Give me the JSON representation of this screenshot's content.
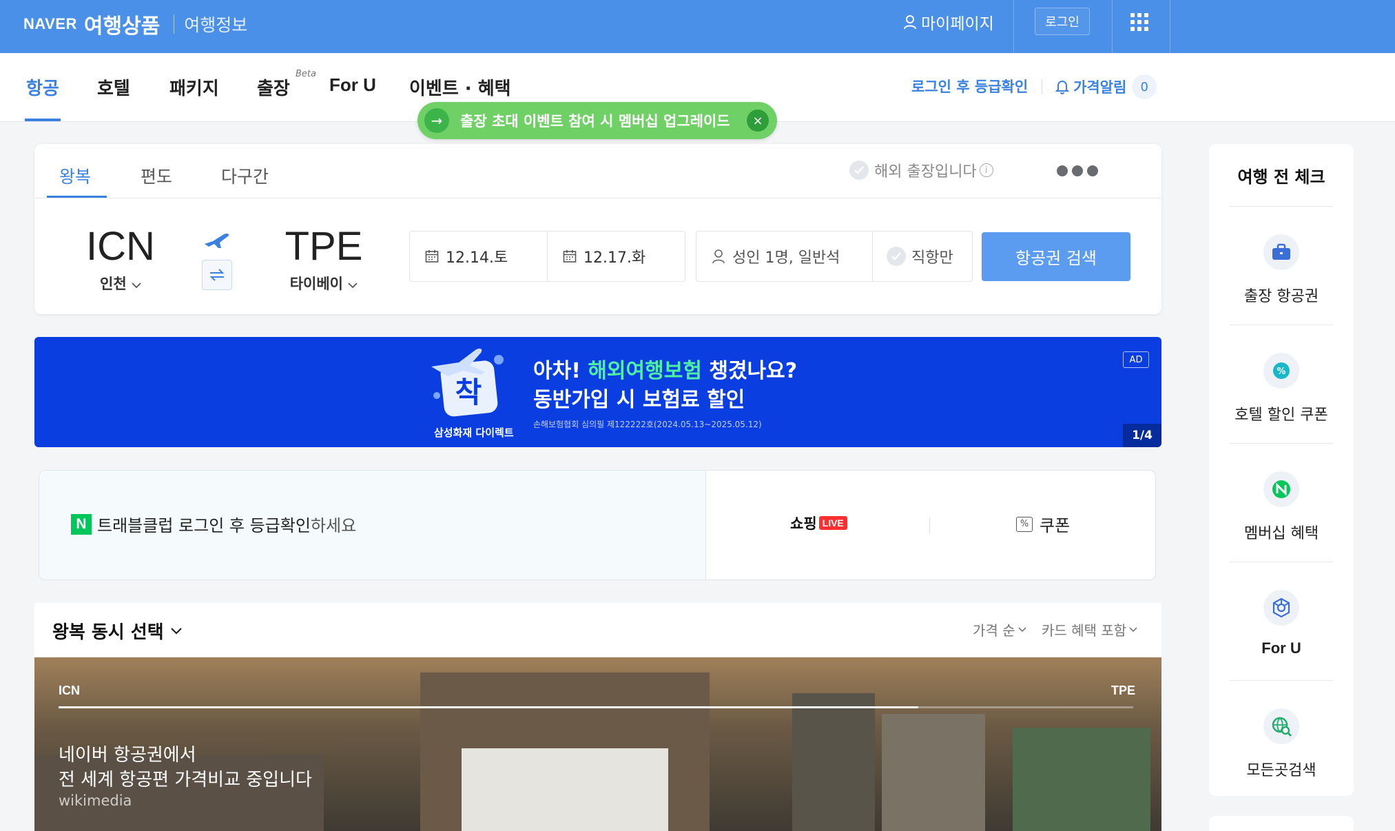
{
  "header": {
    "brand": "NAVER",
    "service": "여행상품",
    "info_link": "여행정보",
    "mypage": "마이페이지",
    "login": "로그인"
  },
  "nav": {
    "tabs": [
      {
        "label": "항공",
        "active": true
      },
      {
        "label": "호텔"
      },
      {
        "label": "패키지"
      },
      {
        "label": "출장",
        "badge": "Beta"
      },
      {
        "label": "For U"
      },
      {
        "label": "이벤트 · 혜택"
      }
    ],
    "login_grade": "로그인 후 등급확인",
    "price_alert": "가격알림",
    "price_alert_count": "0"
  },
  "promo": {
    "text": "출장 초대 이벤트 참여 시 멤버십 업그레이드",
    "arrow": "→",
    "close": "×"
  },
  "search": {
    "trip_tabs": [
      "왕복",
      "편도",
      "다구간"
    ],
    "biz_trip": "해외 출장입니다",
    "info": "i",
    "origin": {
      "code": "ICN",
      "name": "인천"
    },
    "destination": {
      "code": "TPE",
      "name": "타이베이"
    },
    "depart_date": "12.14.토",
    "return_date": "12.17.화",
    "passengers": "성인 1명, 일반석",
    "direct_only": "직항만",
    "search_button": "항공권 검색"
  },
  "ad": {
    "logo_char": "착",
    "company": "삼성화재 다이렉트",
    "line1_pre": "아차! ",
    "line1_hl": "해외여행보험",
    "line1_post": " 챙겼나요?",
    "line2": "동반가입 시 보험료 할인",
    "fine_print": "손해보험협회 심의필 제122222호(2024.05.13~2025.05.12)",
    "tag": "AD",
    "counter": "1/4"
  },
  "club": {
    "badge": "N",
    "text": "트래블클럽 로그인 후 등급확인",
    "suffix": " 하세요",
    "shopping": "쇼핑",
    "live": "LIVE",
    "coupon_icon": "%",
    "coupon": "쿠폰"
  },
  "results": {
    "title": "왕복 동시 선택",
    "sort": "가격 순",
    "card": "카드 혜택 포함",
    "route_from": "ICN",
    "route_to": "TPE",
    "route_progress": 0.8,
    "hero_line1": "네이버 항공권에서",
    "hero_line2": "전 세계 항공편 가격비교 중입니다",
    "credit": "wikimedia"
  },
  "sidebar": {
    "title": "여행 전 체크",
    "items": [
      {
        "label": "출장 항공권",
        "icon": "briefcase-icon"
      },
      {
        "label": "호텔 할인 쿠폰",
        "icon": "percent-icon"
      },
      {
        "label": "멤버십 혜택",
        "icon": "naver-n-icon"
      },
      {
        "label": "For U",
        "icon": "foru-icon"
      },
      {
        "label": "모든곳검색",
        "icon": "globe-search-icon"
      }
    ]
  },
  "colors": {
    "brand_blue": "#4a90e8",
    "accent_blue": "#3b82e0",
    "promo_green": "#6fd165",
    "ad_blue": "#0a3ee0",
    "naver_green": "#03c75a"
  }
}
